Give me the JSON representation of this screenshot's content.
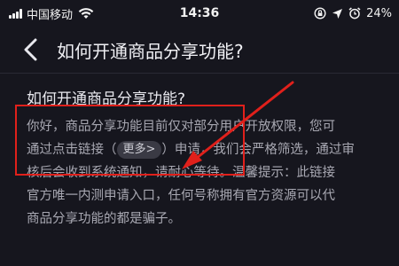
{
  "status_bar": {
    "carrier": "中国移动",
    "time": "14:36",
    "battery": "24%",
    "icons": [
      "signal-icon",
      "wifi-icon",
      "rotation-lock-icon",
      "location-icon",
      "alarm-icon",
      "battery-icon"
    ]
  },
  "nav": {
    "back_icon": "chevron-left-icon",
    "title": "如何开通商品分享功能?"
  },
  "article": {
    "title": "如何开通商品分享功能?",
    "lines": [
      "你好，商品分享功能目前仅对部分用户开放权限，您可",
      "通过点击链接（",
      "）申请，我们会严格筛选，通过审",
      "核后会收到系统通知，请耐心等待。温馨提示：此链接",
      "官方唯一内测申请入口，任何号称拥有官方资源可以代",
      "商品分享功能的都是骗子。"
    ],
    "more_link": "更多>"
  },
  "annotation_color": "#e0201b"
}
